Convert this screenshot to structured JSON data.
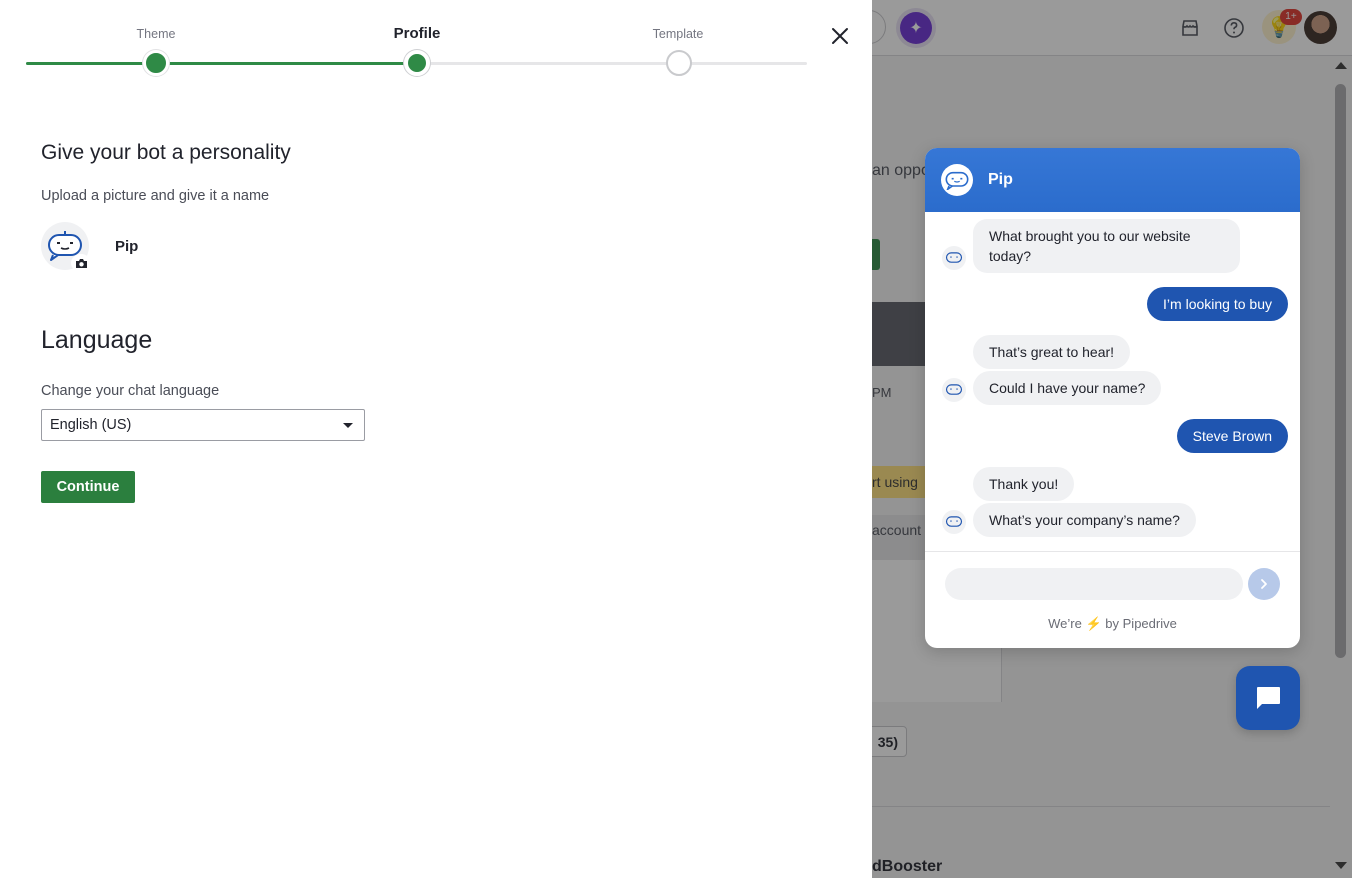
{
  "stepper": {
    "steps": [
      {
        "label": "Theme",
        "state": "done"
      },
      {
        "label": "Profile",
        "state": "current"
      },
      {
        "label": "Template",
        "state": "todo"
      }
    ],
    "accent_color": "#2f8a46"
  },
  "profile": {
    "heading": "Give your bot a personality",
    "subheading": "Upload a picture and give it a name",
    "bot_name": "Pip"
  },
  "language": {
    "heading": "Language",
    "label": "Change your chat language",
    "selected": "English (US)"
  },
  "continue_label": "Continue",
  "chat_preview": {
    "bot_name": "Pip",
    "header_color": "#2b6ccc",
    "messages": [
      {
        "from": "bot",
        "text": "What brought you to our website"
      },
      {
        "from": "bot",
        "text": "today?"
      },
      {
        "from": "user",
        "text": "I’m looking to buy"
      },
      {
        "from": "bot",
        "text": "That’s great to hear!"
      },
      {
        "from": "bot",
        "text": "Could I have your name?"
      },
      {
        "from": "user",
        "text": "Steve Brown"
      },
      {
        "from": "bot",
        "text": "Thank you!"
      },
      {
        "from": "bot",
        "text": "What’s your company’s name?"
      }
    ],
    "powered_prefix": "We’re",
    "powered_suffix": "by Pipedrive"
  },
  "background_app": {
    "notification_badge": "1+",
    "fragments": {
      "opportunity": "an oppo",
      "time": "PM",
      "banner": "rt using",
      "account": "account",
      "chip": "35)",
      "booster": "dBooster"
    },
    "icons": [
      "marketplace-icon",
      "help-icon",
      "lightbulb-icon"
    ]
  }
}
